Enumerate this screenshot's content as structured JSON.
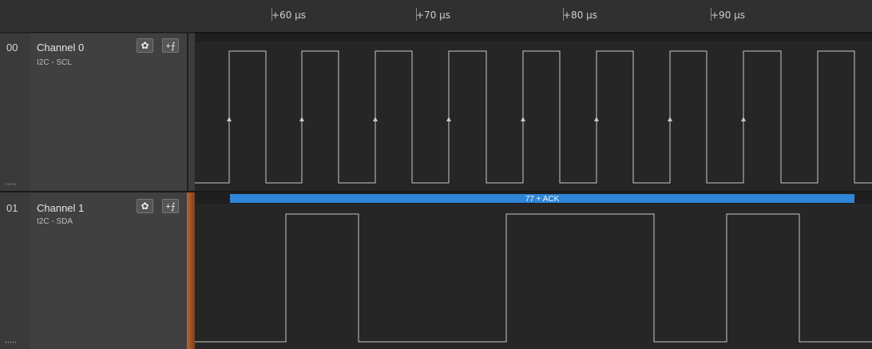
{
  "ruler": {
    "ticks": [
      "+60 µs",
      "+70 µs",
      "+80 µs",
      "+90 µs"
    ]
  },
  "channels": [
    {
      "index": "00",
      "name": "Channel 0",
      "sub_label": "I2C - SCL",
      "color": "#3c3c3c",
      "settings_icon": "gear-icon",
      "trigger_icon": "trigger-edge-icon"
    },
    {
      "index": "01",
      "name": "Channel 1",
      "sub_label": "I2C - SDA",
      "color": "#a0582a",
      "settings_icon": "gear-icon",
      "trigger_icon": "trigger-edge-icon"
    }
  ],
  "decoder": {
    "label": "77 + ACK",
    "color": "#2f86d8"
  },
  "colors": {
    "wave": "#c8c8c8",
    "background": "#262626"
  }
}
